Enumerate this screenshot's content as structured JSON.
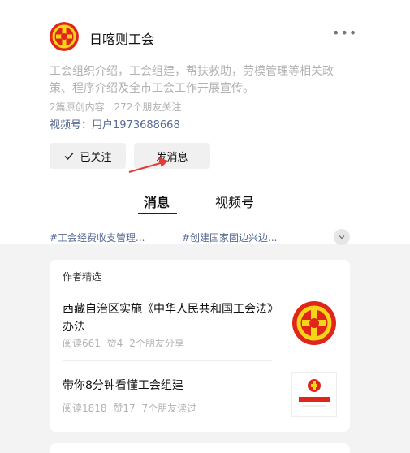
{
  "account": {
    "name": "日喀则工会",
    "description": "工会组织介绍，工会组建，帮扶救助，劳模管理等相关政策、程序介绍及全市工会工作开展宣传。",
    "original_count": "2篇原创内容",
    "friends_follow": "272个朋友关注",
    "channel_id": "视频号：用户1973688668"
  },
  "buttons": {
    "follow": "已关注",
    "message": "发消息"
  },
  "tabs": [
    {
      "label": "消息"
    },
    {
      "label": "视频号"
    }
  ],
  "hashtags": [
    "#工会经费收支管理...",
    "#创建国家固边兴边..."
  ],
  "featured": {
    "title": "作者精选",
    "articles": [
      {
        "title": "西藏自治区实施《中华人民共和国工会法》办法",
        "reads": "阅读661",
        "likes": "赞4",
        "social": "2个朋友分享"
      },
      {
        "title": "带你8分钟看懂工会组建",
        "reads": "阅读1818",
        "likes": "赞17",
        "social": "7个朋友读过"
      }
    ]
  },
  "colors": {
    "link": "#576b95",
    "muted": "#b2b2b2",
    "logo_red": "#e0261b",
    "logo_yellow": "#f7d417",
    "arrow_red": "#e53935"
  }
}
